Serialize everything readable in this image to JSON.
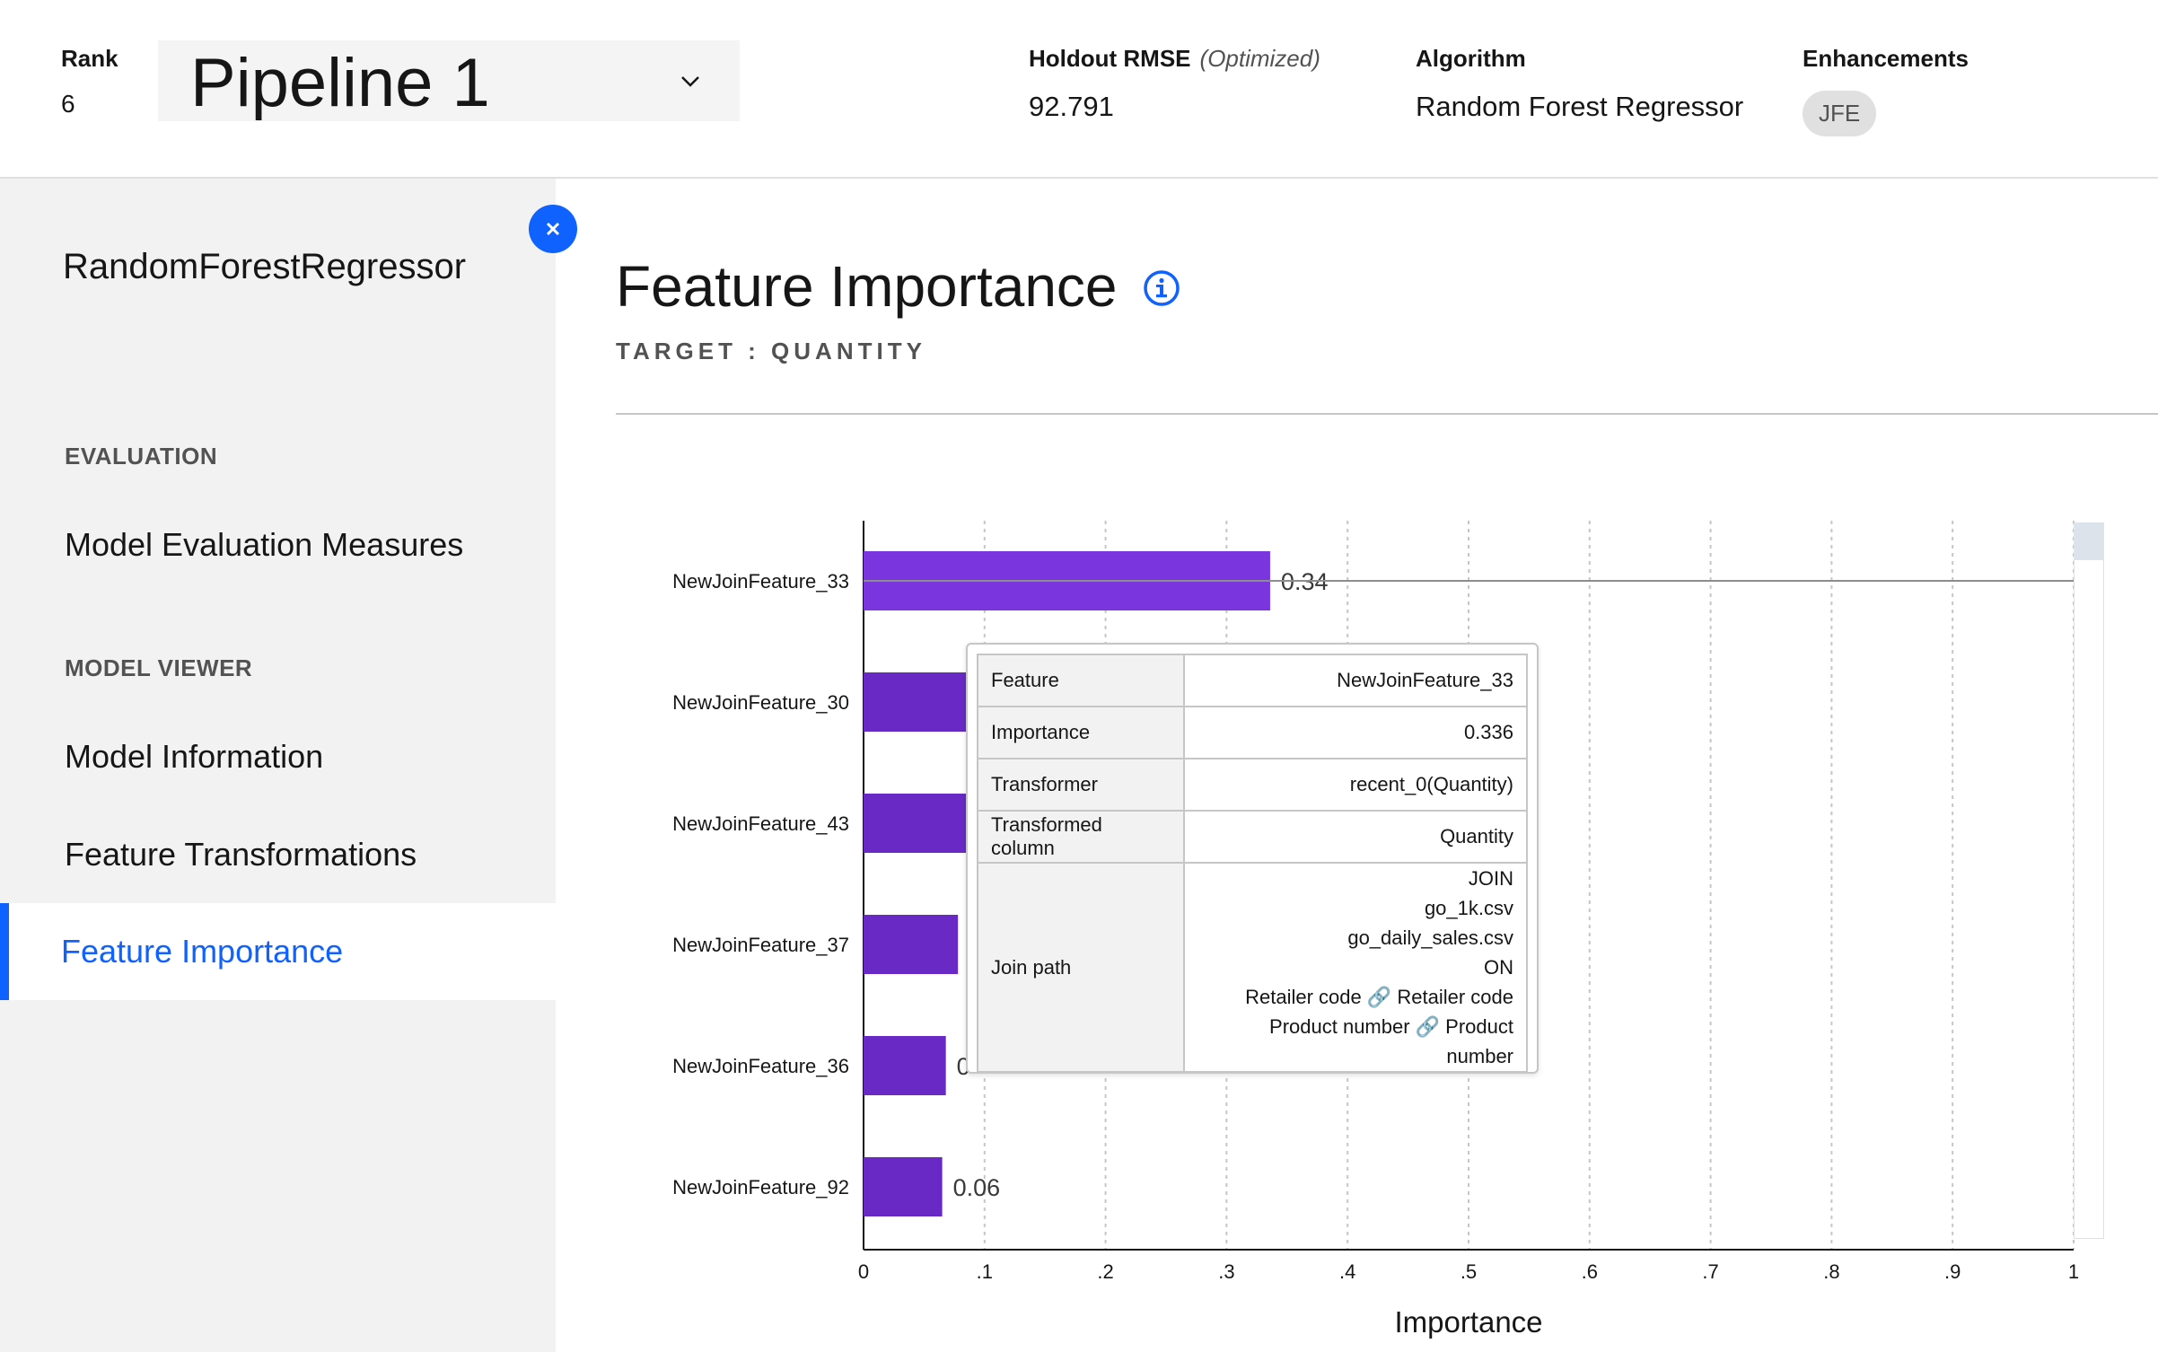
{
  "header": {
    "rank_label": "Rank",
    "rank_value": "6",
    "pipeline_selected": "Pipeline 1",
    "holdout_label": "Holdout RMSE",
    "holdout_qualifier": "(Optimized)",
    "holdout_value": "92.791",
    "algorithm_label": "Algorithm",
    "algorithm_value": "Random Forest Regressor",
    "enhancements_label": "Enhancements",
    "enhancement_tag": "JFE"
  },
  "sidebar": {
    "title": "RandomForestRegressor",
    "section_evaluation": "EVALUATION",
    "item_model_evaluation": "Model Evaluation Measures",
    "section_model_viewer": "MODEL VIEWER",
    "item_model_information": "Model Information",
    "item_feature_transformations": "Feature Transformations",
    "item_feature_importance": "Feature Importance"
  },
  "main": {
    "title": "Feature Importance",
    "target_label": "TARGET : QUANTITY"
  },
  "tooltip": {
    "rows": [
      {
        "key": "Feature",
        "value": "NewJoinFeature_33"
      },
      {
        "key": "Importance",
        "value": "0.336"
      },
      {
        "key": "Transformer",
        "value": "recent_0(Quantity)"
      },
      {
        "key": "Transformed column",
        "value": "Quantity"
      }
    ],
    "join_key": "Join path",
    "join_lines": [
      "JOIN",
      "go_1k.csv",
      "go_daily_sales.csv",
      "ON",
      "Retailer code 🔗 Retailer code",
      "Product number 🔗 Product number"
    ]
  },
  "colors": {
    "accent": "#0f62fe",
    "bar": "#6929c4",
    "bar_highlight": "#7a35de"
  },
  "chart_data": {
    "type": "bar",
    "orientation": "horizontal",
    "categories": [
      "NewJoinFeature_33",
      "NewJoinFeature_30",
      "NewJoinFeature_43",
      "NewJoinFeature_37",
      "NewJoinFeature_36",
      "NewJoinFeature_92"
    ],
    "values": [
      0.336,
      0.11,
      0.1,
      0.078,
      0.068,
      0.065
    ],
    "data_labels": [
      "0.34",
      "",
      "",
      "",
      "0",
      "0.06"
    ],
    "xlabel": "Importance",
    "ylabel": "",
    "xlim": [
      0,
      1
    ],
    "x_ticks": [
      "0",
      ".1",
      ".2",
      ".3",
      ".4",
      ".5",
      ".6",
      ".7",
      ".8",
      ".9",
      "1"
    ],
    "grid": true
  }
}
